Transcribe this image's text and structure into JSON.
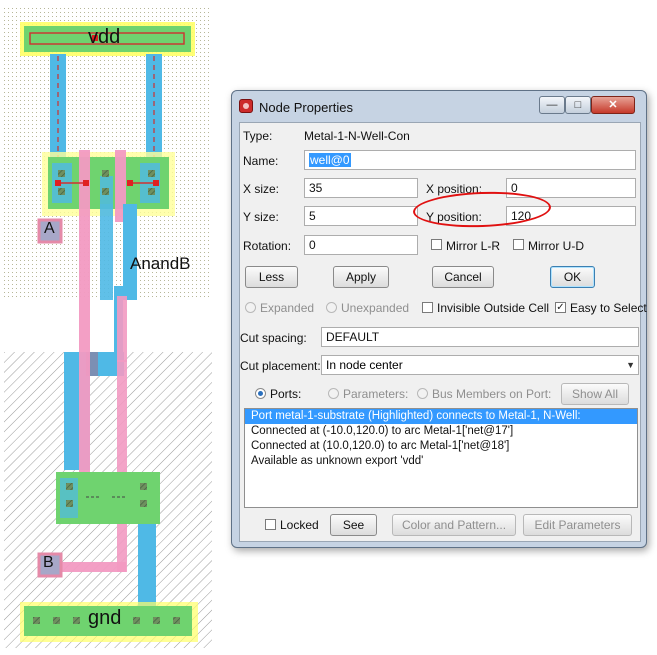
{
  "layout": {
    "labels": {
      "vdd": "vdd",
      "gnd": "gnd",
      "a": "A",
      "b": "B",
      "out": "AnandB"
    },
    "colors": {
      "metal1": "#4fb9e6",
      "poly": "#f29ac2",
      "active": "#6fd36f",
      "label_box": "#a7a7c8",
      "highlight": "#ffff66",
      "well_dots": "#b7b799",
      "hatch": "#9a9a9a"
    }
  },
  "dialog": {
    "title": "Node Properties",
    "window_buttons": {
      "minimize": "—",
      "maximize": "□",
      "close": "✕"
    },
    "type_label": "Type:",
    "type_value": "Metal-1-N-Well-Con",
    "name_label": "Name:",
    "name_value": "well@0",
    "x_size_label": "X size:",
    "x_size_value": "35",
    "x_position_label": "X position:",
    "x_position_value": "0",
    "y_size_label": "Y size:",
    "y_size_value": "5",
    "y_position_label": "Y position:",
    "y_position_value": "120",
    "rotation_label": "Rotation:",
    "rotation_value": "0",
    "mirror_lr_label": "Mirror L-R",
    "mirror_ud_label": "Mirror U-D",
    "less_button": "Less",
    "apply_button": "Apply",
    "cancel_button": "Cancel",
    "ok_button": "OK",
    "expanded_label": "Expanded",
    "unexpanded_label": "Unexpanded",
    "invisible_outside_cell_label": "Invisible Outside Cell",
    "easy_to_select_label": "Easy to Select",
    "easy_to_select_checked": true,
    "cut_spacing_label": "Cut spacing:",
    "cut_spacing_value": "DEFAULT",
    "cut_placement_label": "Cut placement:",
    "cut_placement_value": "In node center",
    "ports_label": "Ports:",
    "parameters_label": "Parameters:",
    "bus_members_label": "Bus Members on Port:",
    "show_all_button": "Show All",
    "list_items": [
      "Port metal-1-substrate (Highlighted) connects to Metal-1, N-Well:",
      "Connected at (-10.0,120.0) to arc Metal-1['net@17']",
      "Connected at (10.0,120.0) to arc Metal-1['net@18']",
      "Available as unknown export 'vdd'"
    ],
    "locked_label": "Locked",
    "see_button": "See",
    "color_pattern_button": "Color and Pattern...",
    "edit_parameters_button": "Edit Parameters",
    "annotation_color": "#e01010"
  }
}
